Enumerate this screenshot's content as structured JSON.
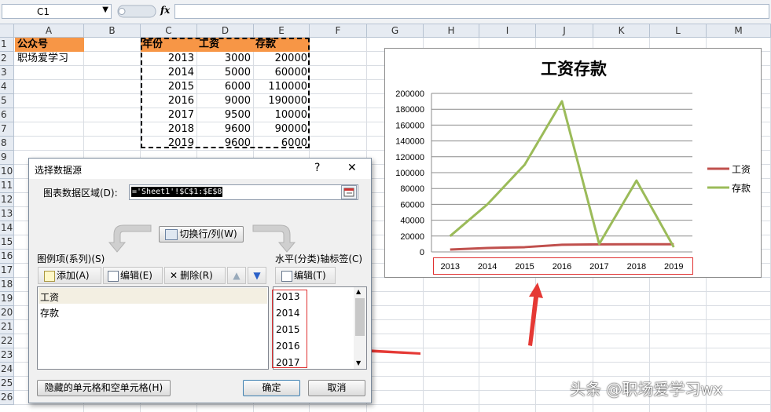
{
  "name_box": {
    "cell": "C1",
    "fx_label": "fx"
  },
  "columns": [
    "A",
    "B",
    "C",
    "D",
    "E",
    "F",
    "G",
    "H",
    "I",
    "J",
    "K",
    "L",
    "M"
  ],
  "rows": [
    "1",
    "2",
    "3",
    "4",
    "5",
    "6",
    "7",
    "8",
    "9",
    "10",
    "11",
    "12",
    "13",
    "14",
    "15",
    "16",
    "17",
    "18",
    "19",
    "20",
    "21",
    "22",
    "23",
    "24",
    "25",
    "26"
  ],
  "sheet": {
    "a1": "公众号",
    "a2": "职场爱学习",
    "headers": [
      "年份",
      "工资",
      "存款"
    ],
    "table": [
      [
        "2013",
        "3000",
        "20000"
      ],
      [
        "2014",
        "5000",
        "60000"
      ],
      [
        "2015",
        "6000",
        "110000"
      ],
      [
        "2016",
        "9000",
        "190000"
      ],
      [
        "2017",
        "9500",
        "10000"
      ],
      [
        "2018",
        "9600",
        "90000"
      ],
      [
        "2019",
        "9600",
        "6000"
      ]
    ]
  },
  "colors": {
    "salary": "#c0504d",
    "savings": "#9bbb59",
    "header_fill": "#f79646",
    "highlight": "#e03030"
  },
  "chart_data": {
    "type": "line",
    "title": "工资存款",
    "categories": [
      "2013",
      "2014",
      "2015",
      "2016",
      "2017",
      "2018",
      "2019"
    ],
    "series": [
      {
        "name": "工资",
        "values": [
          3000,
          5000,
          6000,
          9000,
          9500,
          9600,
          9600
        ]
      },
      {
        "name": "存款",
        "values": [
          20000,
          60000,
          110000,
          190000,
          10000,
          90000,
          6000
        ]
      }
    ],
    "ylim": [
      0,
      200000
    ],
    "yticks": [
      "0",
      "20000",
      "40000",
      "60000",
      "80000",
      "100000",
      "120000",
      "140000",
      "160000",
      "180000",
      "200000"
    ],
    "grid": true,
    "legend": "right"
  },
  "dialog": {
    "title": "选择数据源",
    "help": "?",
    "close": "✕",
    "range_label": "图表数据区域(D):",
    "range_value": "='Sheet1'!$C$1:$E$8",
    "switch_button": "切换行/列(W)",
    "legend_section": "图例项(系列)(S)",
    "add_button": "添加(A)",
    "edit_button": "编辑(E)",
    "delete_button": "删除(R)",
    "series_items": [
      "工资",
      "存款"
    ],
    "axis_section": "水平(分类)轴标签(C)",
    "axis_edit_button": "编辑(T)",
    "axis_items": [
      "2013",
      "2014",
      "2015",
      "2016",
      "2017"
    ],
    "hidden_button": "隐藏的单元格和空单元格(H)",
    "ok_button": "确定",
    "cancel_button": "取消"
  },
  "watermark": "头条 @职场爱学习wx"
}
